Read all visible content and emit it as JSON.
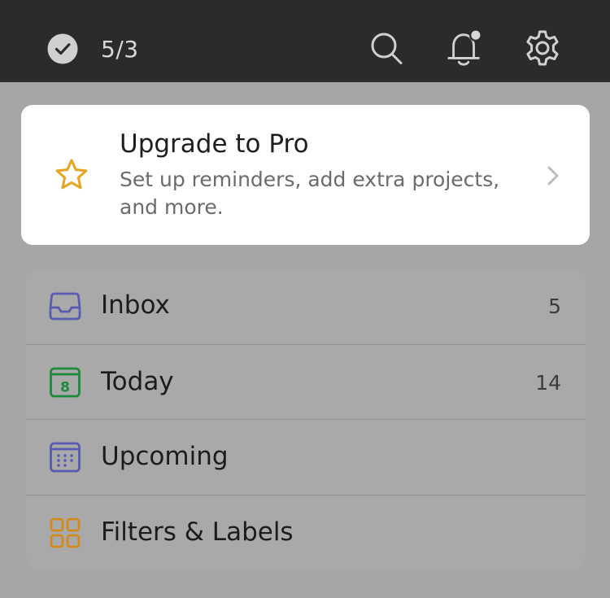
{
  "header": {
    "karma_count": "5/3",
    "icons": {
      "karma": "check-circle-icon",
      "search": "search-icon",
      "notifications": "bell-icon",
      "settings": "gear-icon"
    },
    "has_unread_notifications": true
  },
  "upgrade": {
    "title": "Upgrade to Pro",
    "subtitle": "Set up reminders, add extra projects, and more.",
    "icon": "star-icon",
    "accent_color": "#e5a41f"
  },
  "nav": {
    "items": [
      {
        "label": "Inbox",
        "count": "5",
        "icon": "inbox-icon",
        "color": "#5a5ab0"
      },
      {
        "label": "Today",
        "count": "14",
        "icon": "calendar-today-icon",
        "day": "8",
        "color": "#1f8a3c"
      },
      {
        "label": "Upcoming",
        "count": "",
        "icon": "calendar-upcoming-icon",
        "color": "#5a5ab0"
      },
      {
        "label": "Filters & Labels",
        "count": "",
        "icon": "grid-icon",
        "color": "#d08a1e"
      }
    ]
  }
}
